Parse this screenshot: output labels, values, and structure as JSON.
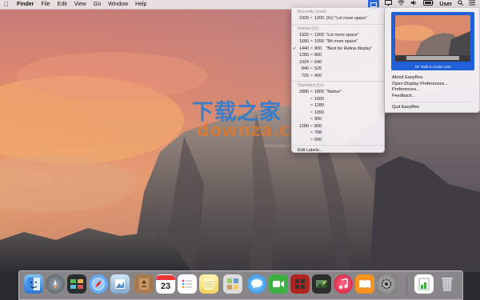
{
  "menubar": {
    "app_name": "Finder",
    "items": [
      "File",
      "Edit",
      "View",
      "Go",
      "Window",
      "Help"
    ],
    "user": "User"
  },
  "dropdown": {
    "recent_header": "Recently Used",
    "recent": [
      {
        "w": "1920",
        "h": "1200",
        "suffix": "(2x)",
        "note": "\"Lot more space\""
      }
    ],
    "retina_header": "Retina (2x)",
    "retina": [
      {
        "w": "1920",
        "h": "1200",
        "note": "\"Lot more space\"",
        "checked": false
      },
      {
        "w": "1680",
        "h": "1050",
        "note": "\"Bit more space\"",
        "checked": false
      },
      {
        "w": "1440",
        "h": "900",
        "note": "\"Best for Retina display\"",
        "checked": true
      },
      {
        "w": "1280",
        "h": "800",
        "note": "",
        "checked": false
      },
      {
        "w": "1024",
        "h": "640",
        "note": "",
        "checked": false
      },
      {
        "w": "840",
        "h": "525",
        "note": "",
        "checked": false
      },
      {
        "w": "720",
        "h": "450",
        "note": "",
        "checked": false
      }
    ],
    "standard_header": "Standard (1x)",
    "standard": [
      {
        "w": "2880",
        "h": "1800",
        "note": "\"Native\""
      },
      {
        "w": "",
        "h": "1600",
        "note": ""
      },
      {
        "w": "",
        "h": "1280",
        "note": ""
      },
      {
        "w": "",
        "h": "1050",
        "note": ""
      },
      {
        "w": "",
        "h": "900",
        "note": ""
      },
      {
        "w": "1280",
        "h": "800",
        "note": ""
      },
      {
        "w": "",
        "h": "768",
        "note": ""
      },
      {
        "w": "",
        "h": "600",
        "note": ""
      }
    ],
    "edit_labels": "Edit Labels..."
  },
  "panel": {
    "display_caption": "15\" Built-in Color LCD",
    "items": [
      "About EasyRes",
      "Open Display Preferences...",
      "Preferences...",
      "Feedback..."
    ],
    "quit": "Quit EasyRes"
  },
  "watermark": {
    "cn": "下载之家",
    "en": "downza.cn",
    "small": "www.downza.cn"
  },
  "dock": {
    "calendar_day": "23",
    "apps": [
      "finder",
      "launchpad",
      "mission-control",
      "safari",
      "preview",
      "contacts",
      "calendar",
      "reminders",
      "notes",
      "photo-booth",
      "messages",
      "facetime",
      "photo-booth-2",
      "photos",
      "itunes",
      "ibooks",
      "system-preferences",
      "documents",
      "trash"
    ]
  }
}
